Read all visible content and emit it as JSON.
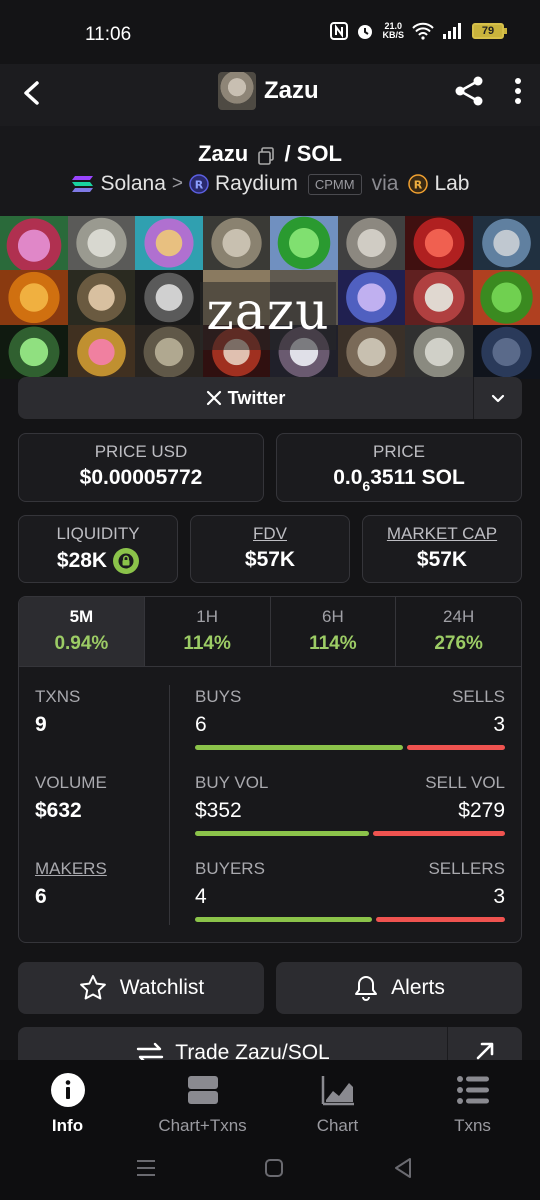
{
  "status_bar": {
    "time": "11:06",
    "net_speed_value": "21.0",
    "net_speed_unit": "KB/S",
    "battery": "79"
  },
  "header": {
    "title": "Zazu"
  },
  "pair": {
    "base": "Zazu",
    "separator": "/",
    "quote": "SOL"
  },
  "chain": {
    "network": "Solana",
    "chevron": ">",
    "dex": "Raydium",
    "pool_type": "CPMM",
    "via": "via",
    "launchpad": "Lab"
  },
  "banner": {
    "text": "zazu"
  },
  "social": {
    "twitter_label": "Twitter"
  },
  "price": {
    "usd_label": "PRICE USD",
    "usd_value": "$0.00005772",
    "native_label": "PRICE",
    "native_prefix": "0.0",
    "native_zeros": "6",
    "native_rest": "3511 SOL"
  },
  "metrics": {
    "liquidity_label": "LIQUIDITY",
    "liquidity_value": "$28K",
    "fdv_label": "FDV",
    "fdv_value": "$57K",
    "mcap_label": "MARKET CAP",
    "mcap_value": "$57K"
  },
  "timeframes": [
    {
      "label": "5M",
      "change": "0.94%",
      "active": true
    },
    {
      "label": "1H",
      "change": "114%",
      "active": false
    },
    {
      "label": "6H",
      "change": "114%",
      "active": false
    },
    {
      "label": "24H",
      "change": "276%",
      "active": false
    }
  ],
  "stats": {
    "txns_label": "TXNS",
    "txns_value": "9",
    "buys_label": "BUYS",
    "buys_value": "6",
    "sells_label": "SELLS",
    "sells_value": "3",
    "volume_label": "VOLUME",
    "volume_value": "$632",
    "buy_vol_label": "BUY VOL",
    "buy_vol_value": "$352",
    "sell_vol_label": "SELL VOL",
    "sell_vol_value": "$279",
    "makers_label": "MAKERS",
    "makers_value": "6",
    "buyers_label": "BUYERS",
    "buyers_value": "4",
    "sellers_label": "SELLERS",
    "sellers_value": "3",
    "buy_ratio_txns": 0.67,
    "buy_ratio_volume": 0.56,
    "buy_ratio_makers": 0.57
  },
  "actions": {
    "watchlist": "Watchlist",
    "alerts": "Alerts",
    "trade": "Trade Zazu/SOL"
  },
  "nav": [
    {
      "label": "Info",
      "icon": "info-icon",
      "active": true
    },
    {
      "label": "Chart+Txns",
      "icon": "split-view-icon",
      "active": false
    },
    {
      "label": "Chart",
      "icon": "chart-icon",
      "active": false
    },
    {
      "label": "Txns",
      "icon": "list-icon",
      "active": false
    }
  ],
  "colors": {
    "positive": "#9ccc65",
    "buy": "#8bc34a",
    "sell": "#ef5350",
    "background": "#141416"
  }
}
